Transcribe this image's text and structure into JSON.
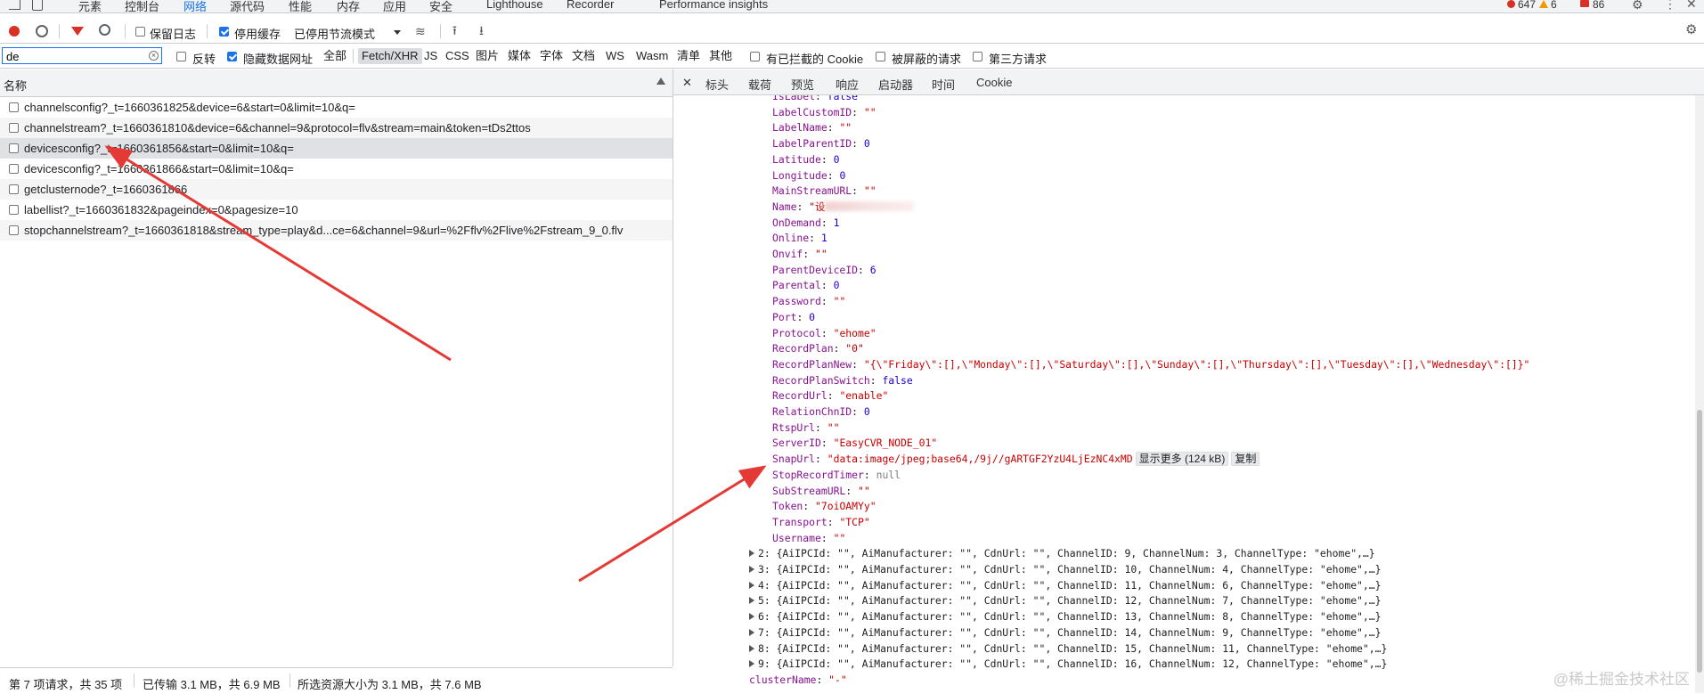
{
  "tabs": {
    "items": [
      "元素",
      "控制台",
      "网络",
      "源代码",
      "性能",
      "内存",
      "应用",
      "安全",
      "Lighthouse",
      "Recorder",
      "Performance insights"
    ],
    "active": "网络"
  },
  "badges": {
    "errors": "647",
    "warnings": "6",
    "issues": "86"
  },
  "toolbar": {
    "preserve_log": "保留日志",
    "disable_cache": "停用缓存",
    "throttle": "已停用节流模式"
  },
  "filter": {
    "value": "de",
    "invert": "反转",
    "hide_data_urls": "隐藏数据网址",
    "types": [
      "全部",
      "Fetch/XHR",
      "JS",
      "CSS",
      "图片",
      "媒体",
      "字体",
      "文档",
      "WS",
      "Wasm",
      "清单",
      "其他"
    ],
    "active_type": "Fetch/XHR",
    "blocked_cookies": "有已拦截的 Cookie",
    "blocked_requests": "被屏蔽的请求",
    "third_party": "第三方请求"
  },
  "requests": {
    "header": "名称",
    "rows": [
      "channelsconfig?_t=1660361825&device=6&start=0&limit=10&q=",
      "channelstream?_t=1660361810&device=6&channel=9&protocol=flv&stream=main&token=tDs2ttos",
      "devicesconfig?_t=1660361856&start=0&limit=10&q=",
      "devicesconfig?_t=1660361866&start=0&limit=10&q=",
      "getclusternode?_t=1660361866",
      "labellist?_t=1660361832&pageindex=0&pagesize=10",
      "stopchannelstream?_t=1660361818&stream_type=play&d...ce=6&channel=9&url=%2Fflv%2Flive%2Fstream_9_0.flv"
    ],
    "selected_index": 2
  },
  "detail_tabs": [
    "标头",
    "载荷",
    "预览",
    "响应",
    "启动器",
    "时间",
    "Cookie"
  ],
  "detail": {
    "lines": [
      {
        "k": "IsLabel",
        "v": "false",
        "t": "b"
      },
      {
        "k": "LabelCustomID",
        "v": "\"\"",
        "t": "s"
      },
      {
        "k": "LabelName",
        "v": "\"\"",
        "t": "s"
      },
      {
        "k": "LabelParentID",
        "v": "0",
        "t": "n"
      },
      {
        "k": "Latitude",
        "v": "0",
        "t": "n"
      },
      {
        "k": "Longitude",
        "v": "0",
        "t": "n"
      },
      {
        "k": "MainStreamURL",
        "v": "\"\"",
        "t": "s"
      },
      {
        "k": "Name",
        "v": "\"设",
        "t": "blur"
      },
      {
        "k": "OnDemand",
        "v": "1",
        "t": "n"
      },
      {
        "k": "Online",
        "v": "1",
        "t": "n"
      },
      {
        "k": "Onvif",
        "v": "\"\"",
        "t": "s"
      },
      {
        "k": "ParentDeviceID",
        "v": "6",
        "t": "n"
      },
      {
        "k": "Parental",
        "v": "0",
        "t": "n"
      },
      {
        "k": "Password",
        "v": "\"\"",
        "t": "s"
      },
      {
        "k": "Port",
        "v": "0",
        "t": "n"
      },
      {
        "k": "Protocol",
        "v": "\"ehome\"",
        "t": "s"
      },
      {
        "k": "RecordPlan",
        "v": "\"0\"",
        "t": "s"
      },
      {
        "k": "RecordPlanNew",
        "v": "\"{\\\"Friday\\\":[],\\\"Monday\\\":[],\\\"Saturday\\\":[],\\\"Sunday\\\":[],\\\"Thursday\\\":[],\\\"Tuesday\\\":[],\\\"Wednesday\\\":[]}\"",
        "t": "s"
      },
      {
        "k": "RecordPlanSwitch",
        "v": "false",
        "t": "b"
      },
      {
        "k": "RecordUrl",
        "v": "\"enable\"",
        "t": "s"
      },
      {
        "k": "RelationChnID",
        "v": "0",
        "t": "n"
      },
      {
        "k": "RtspUrl",
        "v": "\"\"",
        "t": "s"
      },
      {
        "k": "ServerID",
        "v": "\"EasyCVR_NODE_01\"",
        "t": "s"
      },
      {
        "k": "SnapUrl",
        "v": "\"data:image/jpeg;base64,/9j//gARTGF2YzU4LjEzNC4xMD",
        "t": "snap"
      },
      {
        "k": "StopRecordTimer",
        "v": "null",
        "t": "nl"
      },
      {
        "k": "SubStreamURL",
        "v": "\"\"",
        "t": "s"
      },
      {
        "k": "Token",
        "v": "\"7oiOAMYy\"",
        "t": "s"
      },
      {
        "k": "Transport",
        "v": "\"TCP\"",
        "t": "s"
      },
      {
        "k": "Username",
        "v": "\"\"",
        "t": "s"
      }
    ],
    "show_more": "显示更多 (124 kB)",
    "copy": "复制",
    "collapsed": [
      "2: {AiIPCId: \"\", AiManufacturer: \"\", CdnUrl: \"\", ChannelID: 9, ChannelNum: 3, ChannelType: \"ehome\",…}",
      "3: {AiIPCId: \"\", AiManufacturer: \"\", CdnUrl: \"\", ChannelID: 10, ChannelNum: 4, ChannelType: \"ehome\",…}",
      "4: {AiIPCId: \"\", AiManufacturer: \"\", CdnUrl: \"\", ChannelID: 11, ChannelNum: 6, ChannelType: \"ehome\",…}",
      "5: {AiIPCId: \"\", AiManufacturer: \"\", CdnUrl: \"\", ChannelID: 12, ChannelNum: 7, ChannelType: \"ehome\",…}",
      "6: {AiIPCId: \"\", AiManufacturer: \"\", CdnUrl: \"\", ChannelID: 13, ChannelNum: 8, ChannelType: \"ehome\",…}",
      "7: {AiIPCId: \"\", AiManufacturer: \"\", CdnUrl: \"\", ChannelID: 14, ChannelNum: 9, ChannelType: \"ehome\",…}",
      "8: {AiIPCId: \"\", AiManufacturer: \"\", CdnUrl: \"\", ChannelID: 15, ChannelNum: 11, ChannelType: \"ehome\",…}",
      "9: {AiIPCId: \"\", AiManufacturer: \"\", CdnUrl: \"\", ChannelID: 16, ChannelNum: 12, ChannelType: \"ehome\",…}"
    ],
    "last_key": "clusterName",
    "last_val": "\"-\""
  },
  "status": {
    "requests": "第 7 项请求，共 35 项",
    "transferred": "已传输 3.1 MB，共 6.9 MB",
    "resources": "所选资源大小为 3.1 MB，共 7.6 MB"
  },
  "watermark": "@稀土掘金技术社区",
  "colors": {
    "accent": "#1a73e8",
    "arrow": "#e53935",
    "record": "#d93025"
  }
}
